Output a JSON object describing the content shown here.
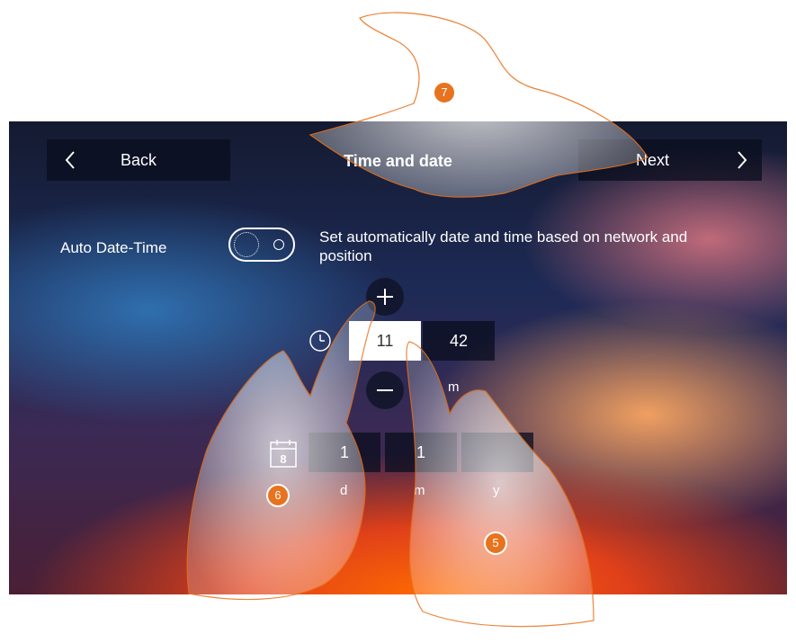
{
  "header": {
    "back_label": "Back",
    "title": "Time and date",
    "next_label": "Next"
  },
  "auto_datetime": {
    "label": "Auto Date-Time",
    "description": "Set automatically date and time based on network and position"
  },
  "time": {
    "hour": "11",
    "minute": "42",
    "minute_unit": "m"
  },
  "date": {
    "calendar_icon_day": "8",
    "day": "1",
    "month": "1",
    "year": "",
    "day_unit": "d",
    "month_unit": "m",
    "year_unit": "y"
  },
  "callouts": {
    "five": "5",
    "six": "6",
    "seven": "7"
  },
  "colors": {
    "callout": "#e8731e",
    "dark_panel": "#0a0e1e"
  },
  "icons": [
    "chevron-left-icon",
    "chevron-right-icon",
    "plus-icon",
    "minus-icon",
    "clock-icon",
    "calendar-icon",
    "pointing-hand"
  ]
}
